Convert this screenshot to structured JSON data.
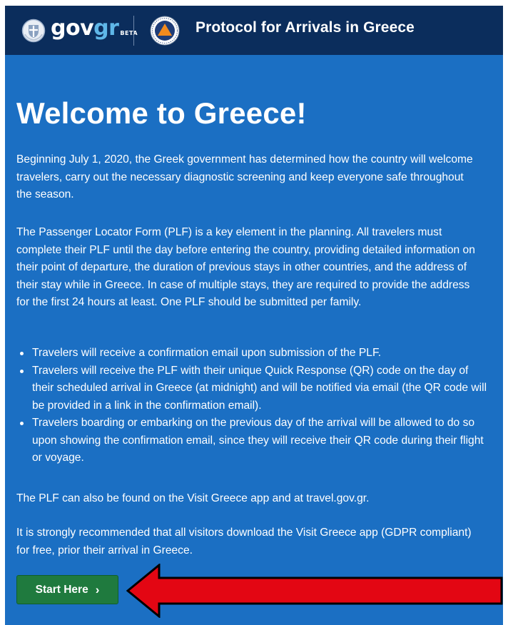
{
  "header": {
    "brand_main": "gov",
    "brand_accent": "gr",
    "brand_badge": "BETA",
    "title": "Protocol for Arrivals in Greece",
    "emblem_icon": "greek-coat-of-arms-icon",
    "logo_icon": "civil-protection-logo-icon"
  },
  "main": {
    "heading": "Welcome to Greece!",
    "intro": "Beginning July 1, 2020, the Greek government has determined how the country will welcome travelers, carry out the necessary diagnostic screening and keep everyone safe throughout the season.",
    "plf_description": "The Passenger Locator Form (PLF) is a key element in the planning. All travelers must complete their PLF until the day before entering the country, providing detailed information on their point of departure, the duration of previous stays in other countries, and the address of their stay while in Greece. In case of multiple stays, they are required to provide the address for the first 24 hours at least. One PLF should be submitted per family.",
    "bullets": [
      "Travelers will receive a confirmation email upon submission of the PLF.",
      "Travelers will receive the PLF with their unique Quick Response (QR) code on the day of their scheduled arrival in Greece (at midnight) and will be notified via email (the QR code will be provided in a link in the confirmation email).",
      "Travelers boarding or embarking on the previous day of the arrival will be allowed to do so upon showing the confirmation email, since they will receive their QR code during their flight or voyage."
    ],
    "app_note": "The PLF can also be found on the Visit Greece app and at travel.gov.gr.",
    "recommendation": "It is strongly recommended that all visitors download the Visit Greece app (GDPR compliant) for free, prior their arrival in Greece.",
    "start_button": "Start Here",
    "start_chevron": "›"
  },
  "colors": {
    "header_bg": "#0b2d5c",
    "content_bg": "#1b6fc3",
    "button_bg": "#1f7a3e",
    "brand_accent": "#5fb7e8",
    "annotation_arrow": "#e30613"
  }
}
